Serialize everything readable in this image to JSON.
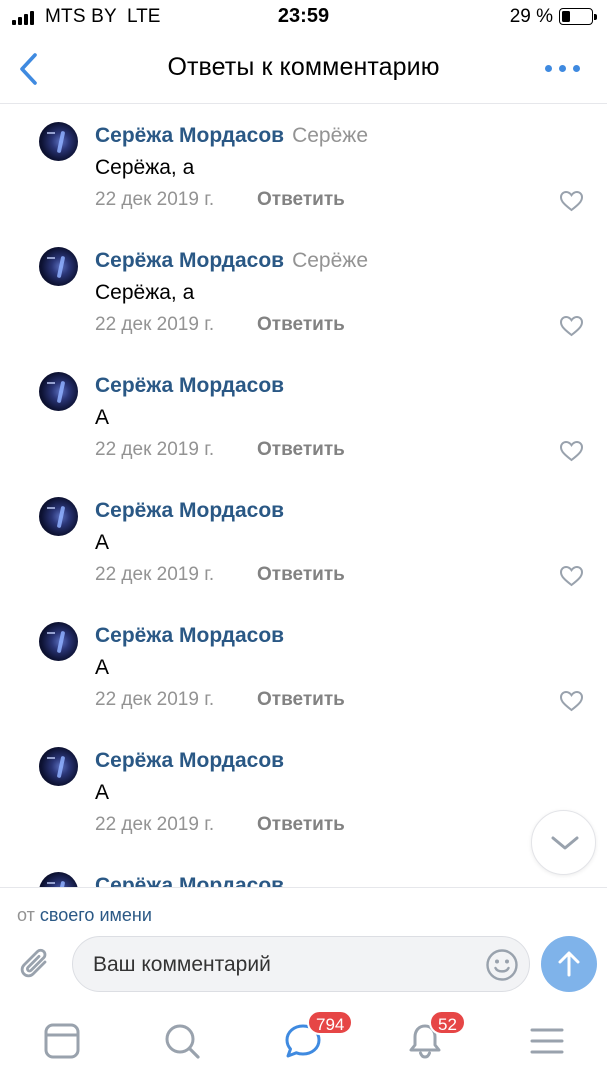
{
  "status_bar": {
    "carrier": "MTS BY",
    "network": "LTE",
    "time": "23:59",
    "battery_percent": "29 %",
    "battery_level": 0.29
  },
  "header": {
    "title": "Ответы к комментарию",
    "back_icon": "chevron-left-icon",
    "more_icon": "more-horizontal-icon"
  },
  "comments": [
    {
      "author": "Серёжа Мордасов",
      "reply_to": "Серёже",
      "text": "Серёжа, а",
      "date": "22 дек 2019 г.",
      "reply_label": "Ответить"
    },
    {
      "author": "Серёжа Мордасов",
      "reply_to": "Серёже",
      "text": "Серёжа, а",
      "date": "22 дек 2019 г.",
      "reply_label": "Ответить"
    },
    {
      "author": "Серёжа Мордасов",
      "reply_to": "",
      "text": "А",
      "date": "22 дек 2019 г.",
      "reply_label": "Ответить"
    },
    {
      "author": "Серёжа Мордасов",
      "reply_to": "",
      "text": "А",
      "date": "22 дек 2019 г.",
      "reply_label": "Ответить"
    },
    {
      "author": "Серёжа Мордасов",
      "reply_to": "",
      "text": "А",
      "date": "22 дек 2019 г.",
      "reply_label": "Ответить"
    },
    {
      "author": "Серёжа Мордасов",
      "reply_to": "",
      "text": "А",
      "date": "22 дек 2019 г.",
      "reply_label": "Ответить"
    },
    {
      "author": "Серёжа Мордасов",
      "reply_to": "",
      "text": "",
      "date": "",
      "reply_label": ""
    }
  ],
  "composer": {
    "from_prefix": "от",
    "from_link": "своего имени",
    "placeholder": "Ваш комментарий"
  },
  "tab_bar": {
    "tabs": [
      {
        "name": "news",
        "icon": "news-feed-icon"
      },
      {
        "name": "search",
        "icon": "search-icon"
      },
      {
        "name": "messages",
        "icon": "messages-icon",
        "badge": "794"
      },
      {
        "name": "notifications",
        "icon": "bell-icon",
        "badge": "52"
      },
      {
        "name": "menu",
        "icon": "menu-icon"
      }
    ]
  },
  "colors": {
    "link": "#2a5885",
    "accent": "#3f8ae0",
    "secondary_text": "#939393",
    "badge": "#e64646",
    "send_button": "#7fb3ea"
  }
}
